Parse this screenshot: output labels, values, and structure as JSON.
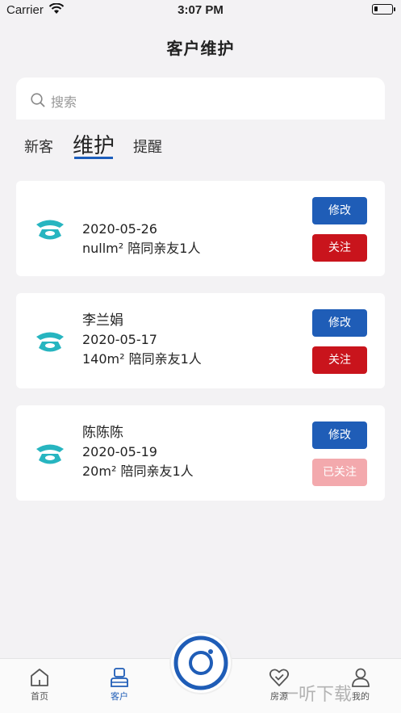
{
  "status_bar": {
    "carrier": "Carrier",
    "time": "3:07 PM"
  },
  "header": {
    "title": "客户维护"
  },
  "search": {
    "placeholder": "搜索"
  },
  "tabs": [
    {
      "label": "新客",
      "active": false
    },
    {
      "label": "维护",
      "active": true
    },
    {
      "label": "提醒",
      "active": false
    }
  ],
  "customers": [
    {
      "name": "",
      "date": "2020-05-26",
      "info": "nullm² 陪同亲友1人",
      "edit_label": "修改",
      "follow_label": "关注",
      "followed": false
    },
    {
      "name": "李兰娟",
      "date": "2020-05-17",
      "info": "140m² 陪同亲友1人",
      "edit_label": "修改",
      "follow_label": "关注",
      "followed": false
    },
    {
      "name": "陈陈陈",
      "date": "2020-05-19",
      "info": "20m² 陪同亲友1人",
      "edit_label": "修改",
      "follow_label": "已关注",
      "followed": true
    }
  ],
  "tabbar": {
    "home": "首页",
    "customer": "客户",
    "housing": "房源",
    "mine": "我的"
  },
  "watermark": "一听下载",
  "colors": {
    "primary_blue": "#1f5db7",
    "follow_red": "#c9141c",
    "followed_pink": "#f3a9ad",
    "phone_teal": "#27b5c0",
    "background": "#f3f2f4"
  },
  "icons": [
    "search-icon",
    "phone-icon",
    "home-icon",
    "customer-icon",
    "camera-icon",
    "heart-check-icon",
    "user-icon",
    "wifi-icon",
    "battery-icon"
  ]
}
